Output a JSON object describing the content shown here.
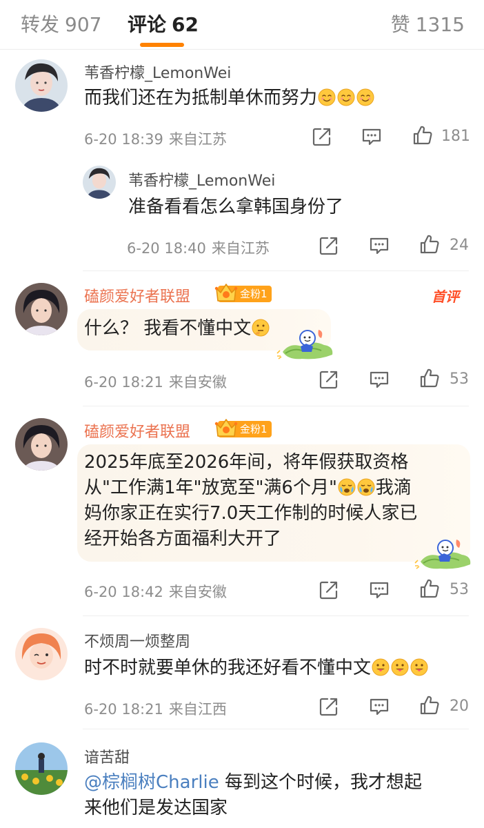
{
  "tabs": {
    "repost": {
      "label": "转发",
      "count": "907"
    },
    "comments": {
      "label": "评论",
      "count": "62"
    },
    "likes": {
      "label": "赞",
      "count": "1315"
    }
  },
  "comments": [
    {
      "username": "苇香柠檬_LemonWei",
      "text": "而我们还在为抵制单休而努力",
      "emoji": [
        "smile-emoji",
        "smile-emoji",
        "smile-emoji"
      ],
      "time": "6-20 18:39",
      "location": "来自江苏",
      "likes": "181",
      "reply": {
        "username": "苇香柠檬_LemonWei",
        "text": "准备看看怎么拿韩国身份了",
        "time": "6-20 18:40",
        "location": "来自江苏",
        "likes": "24"
      }
    },
    {
      "username": "磕颜爱好者联盟",
      "fan_badge": "金粉1",
      "top_tag": "首评",
      "text": "什么？ 我看不懂中文",
      "emoji": [
        "thinking-emoji"
      ],
      "time": "6-20 18:21",
      "location": "来自安徽",
      "likes": "53"
    },
    {
      "username": "磕颜爱好者联盟",
      "fan_badge": "金粉1",
      "text_lines": [
        "2025年底至2026年间，将年假获取资格",
        "从\"工作满1年\"放宽至\"满6个月\"",
        "我滴",
        "妈你家正在实行7.0天工作制的时候人家已",
        "经开始各方面福利大开了"
      ],
      "emoji": [
        "crying-emoji",
        "crying-emoji"
      ],
      "time": "6-20 18:42",
      "location": "来自安徽",
      "likes": "53"
    },
    {
      "username": "不烦周一烦整周",
      "text": "时不时就要单休的我还好看不懂中文",
      "emoji": [
        "tongue-emoji",
        "tongue-emoji",
        "tongue-emoji"
      ],
      "time": "6-20 18:21",
      "location": "来自江西",
      "likes": "20"
    },
    {
      "username": "谙苦甜",
      "mention": "@棕榈树Charlie",
      "text_line1": " 每到这个时候，我才想起",
      "text_line2": "来他们是发达国家"
    }
  ],
  "colors": {
    "accent": "#ff8200",
    "vip_name": "#eb7350",
    "mention": "#4a7fbf",
    "fan_badge": "#ffa21a"
  }
}
